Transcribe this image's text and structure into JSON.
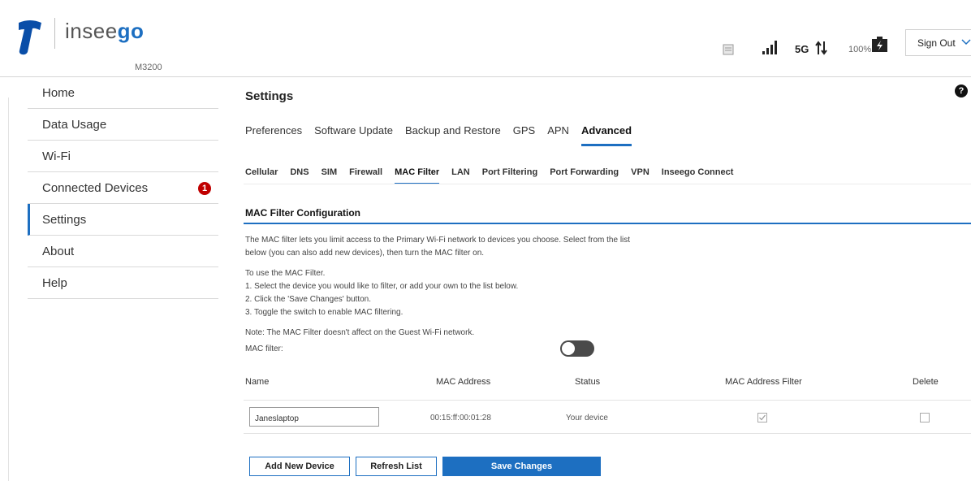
{
  "header": {
    "brand_prefix": "insee",
    "brand_suffix": "go",
    "model": "M3200",
    "network": "5G",
    "battery": "100%",
    "sign_out_label": "Sign Out"
  },
  "sidebar": {
    "items": [
      {
        "label": "Home"
      },
      {
        "label": "Data Usage"
      },
      {
        "label": "Wi-Fi"
      },
      {
        "label": "Connected Devices",
        "badge": "1"
      },
      {
        "label": "Settings",
        "active": true
      },
      {
        "label": "About"
      },
      {
        "label": "Help"
      }
    ]
  },
  "main": {
    "title": "Settings",
    "help_icon": "?",
    "tabs": [
      "Preferences",
      "Software Update",
      "Backup and Restore",
      "GPS",
      "APN",
      "Advanced"
    ],
    "active_tab": "Advanced",
    "subtabs": [
      "Cellular",
      "DNS",
      "SIM",
      "Firewall",
      "MAC Filter",
      "LAN",
      "Port Filtering",
      "Port Forwarding",
      "VPN",
      "Inseego Connect"
    ],
    "active_subtab": "MAC Filter",
    "section_title": "MAC Filter Configuration",
    "description": "The MAC filter lets you limit access to the Primary Wi-Fi network to devices you choose. Select from the list below (you can also add new devices), then turn the MAC filter on.",
    "instructions": [
      "To use the MAC Filter.",
      "1. Select the device you would like to filter, or add your own to the list below.",
      "2. Click the 'Save Changes' button.",
      "3. Toggle the switch to enable MAC filtering."
    ],
    "note": "Note: The MAC Filter doesn't affect on the Guest Wi-Fi network.",
    "toggle_label": "MAC filter:",
    "toggle_on": false,
    "table": {
      "headers": [
        "Name",
        "MAC Address",
        "Status",
        "MAC Address Filter",
        "Delete"
      ],
      "rows": [
        {
          "name": "Janeslaptop",
          "mac": "00:15:ff:00:01:28",
          "status": "Your device",
          "filter_checked": true,
          "delete_checked": false
        }
      ]
    },
    "buttons": {
      "add": "Add New Device",
      "refresh": "Refresh List",
      "save": "Save Changes"
    }
  },
  "colors": {
    "accent": "#1d6fc1",
    "badge": "#c00000",
    "brand_logo": "#0a4ea8"
  },
  "icons": [
    "telstra-logo-icon",
    "message-icon",
    "signal-icon",
    "data-arrows-icon",
    "battery-icon",
    "chevron-down-icon",
    "help-icon",
    "checkmark-icon"
  ]
}
